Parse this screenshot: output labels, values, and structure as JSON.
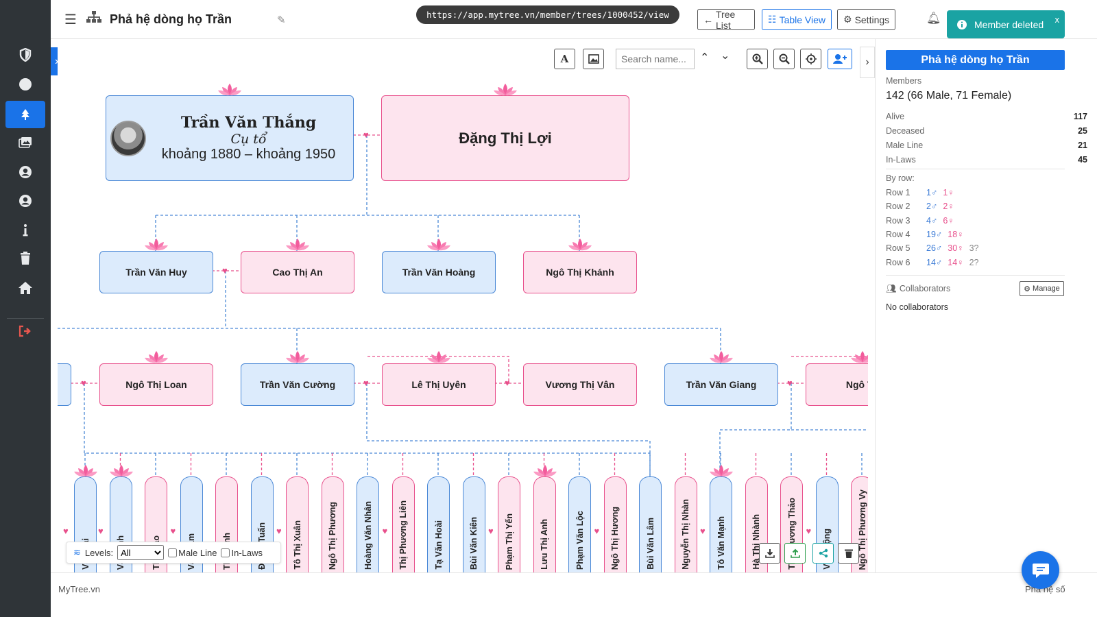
{
  "header": {
    "title": "Phả hệ dòng họ Trần",
    "url": "https://app.mytree.vn/member/trees/1000452/view",
    "tree_list_label": "Tree List",
    "table_view_label": "Table View",
    "settings_label": "Settings"
  },
  "toast": {
    "message": "Member deleted",
    "close": "x"
  },
  "toolbar": {
    "search_placeholder": "Search name..."
  },
  "tree": {
    "root": {
      "name": "Trần Văn Thắng",
      "title": "Cụ tổ",
      "dates": "khoảng 1880 – khoảng 1950"
    },
    "root_spouse": "Đặng Thị Lợi",
    "row2": [
      "Trần Văn Huy",
      "Cao Thị An",
      "Trần Văn Hoàng",
      "Ngô Thị Khánh"
    ],
    "row3": [
      "Ngô Thị Loan",
      "Trần Văn Cường",
      "Lê Thị Uyên",
      "Vương Thị Vân",
      "Trần Văn Giang",
      "Ngô Th"
    ],
    "row4": [
      {
        "name": "Văn Hải",
        "g": "m"
      },
      {
        "name": "Văn Anh",
        "g": "m"
      },
      {
        "name": "Thị Giao",
        "g": "f"
      },
      {
        "name": "Văn Nam",
        "g": "m"
      },
      {
        "name": "Thị Oanh",
        "g": "f"
      },
      {
        "name": "Đ Anh Tuấn",
        "g": "m"
      },
      {
        "name": "Tô Thị Xuân",
        "g": "f"
      },
      {
        "name": "Ngô Thị Phương",
        "g": "f"
      },
      {
        "name": "Hoàng Văn Nhân",
        "g": "m"
      },
      {
        "name": "Thị Phương Liên",
        "g": "f"
      },
      {
        "name": "Tạ Văn Hoài",
        "g": "m"
      },
      {
        "name": "Bùi Văn Kiên",
        "g": "m"
      },
      {
        "name": "Phạm Thị Yến",
        "g": "f"
      },
      {
        "name": "Lưu Thị Anh",
        "g": "f"
      },
      {
        "name": "Phạm Văn Lộc",
        "g": "m"
      },
      {
        "name": "Ngô Thị Hương",
        "g": "f"
      },
      {
        "name": "Bùi Văn Lâm",
        "g": "m"
      },
      {
        "name": "Nguyễn Thị Nhàn",
        "g": "f"
      },
      {
        "name": "Tô Văn Mạnh",
        "g": "m"
      },
      {
        "name": "Hà Thị Nhành",
        "g": "f"
      },
      {
        "name": "Thị Phương Thảo",
        "g": "f"
      },
      {
        "name": "Văn Mộng",
        "g": "m"
      },
      {
        "name": "Ngô Thị Phương Vy",
        "g": "f"
      }
    ]
  },
  "filter": {
    "levels_label": "Levels:",
    "levels_value": "All",
    "male_line": "Male Line",
    "in_laws": "In-Laws"
  },
  "panel": {
    "title": "Phả hệ dòng họ Trần",
    "members_label": "Members",
    "members_summary": "142 (66 Male, 71 Female)",
    "stats": [
      {
        "label": "Alive",
        "value": "117"
      },
      {
        "label": "Deceased",
        "value": "25"
      },
      {
        "label": "Male Line",
        "value": "21"
      },
      {
        "label": "In-Laws",
        "value": "45"
      }
    ],
    "by_row_label": "By row:",
    "rows": [
      {
        "label": "Row 1",
        "m": "1♂",
        "f": "1♀",
        "u": ""
      },
      {
        "label": "Row 2",
        "m": "2♂",
        "f": "2♀",
        "u": ""
      },
      {
        "label": "Row 3",
        "m": "4♂",
        "f": "6♀",
        "u": ""
      },
      {
        "label": "Row 4",
        "m": "19♂",
        "f": "18♀",
        "u": ""
      },
      {
        "label": "Row 5",
        "m": "26♂",
        "f": "30♀",
        "u": "3?"
      },
      {
        "label": "Row 6",
        "m": "14♂",
        "f": "14♀",
        "u": "2?"
      }
    ],
    "collaborators_label": "Collaborators",
    "manage_label": "Manage",
    "no_collaborators": "No collaborators"
  },
  "footer": {
    "left": "MyTree.vn",
    "right": "Phả hệ số"
  },
  "colors": {
    "accent": "#1a73e8",
    "male": "#dcebfc",
    "female": "#fde4ee",
    "toast": "#1aa3a3",
    "rail": "#2f3438"
  }
}
